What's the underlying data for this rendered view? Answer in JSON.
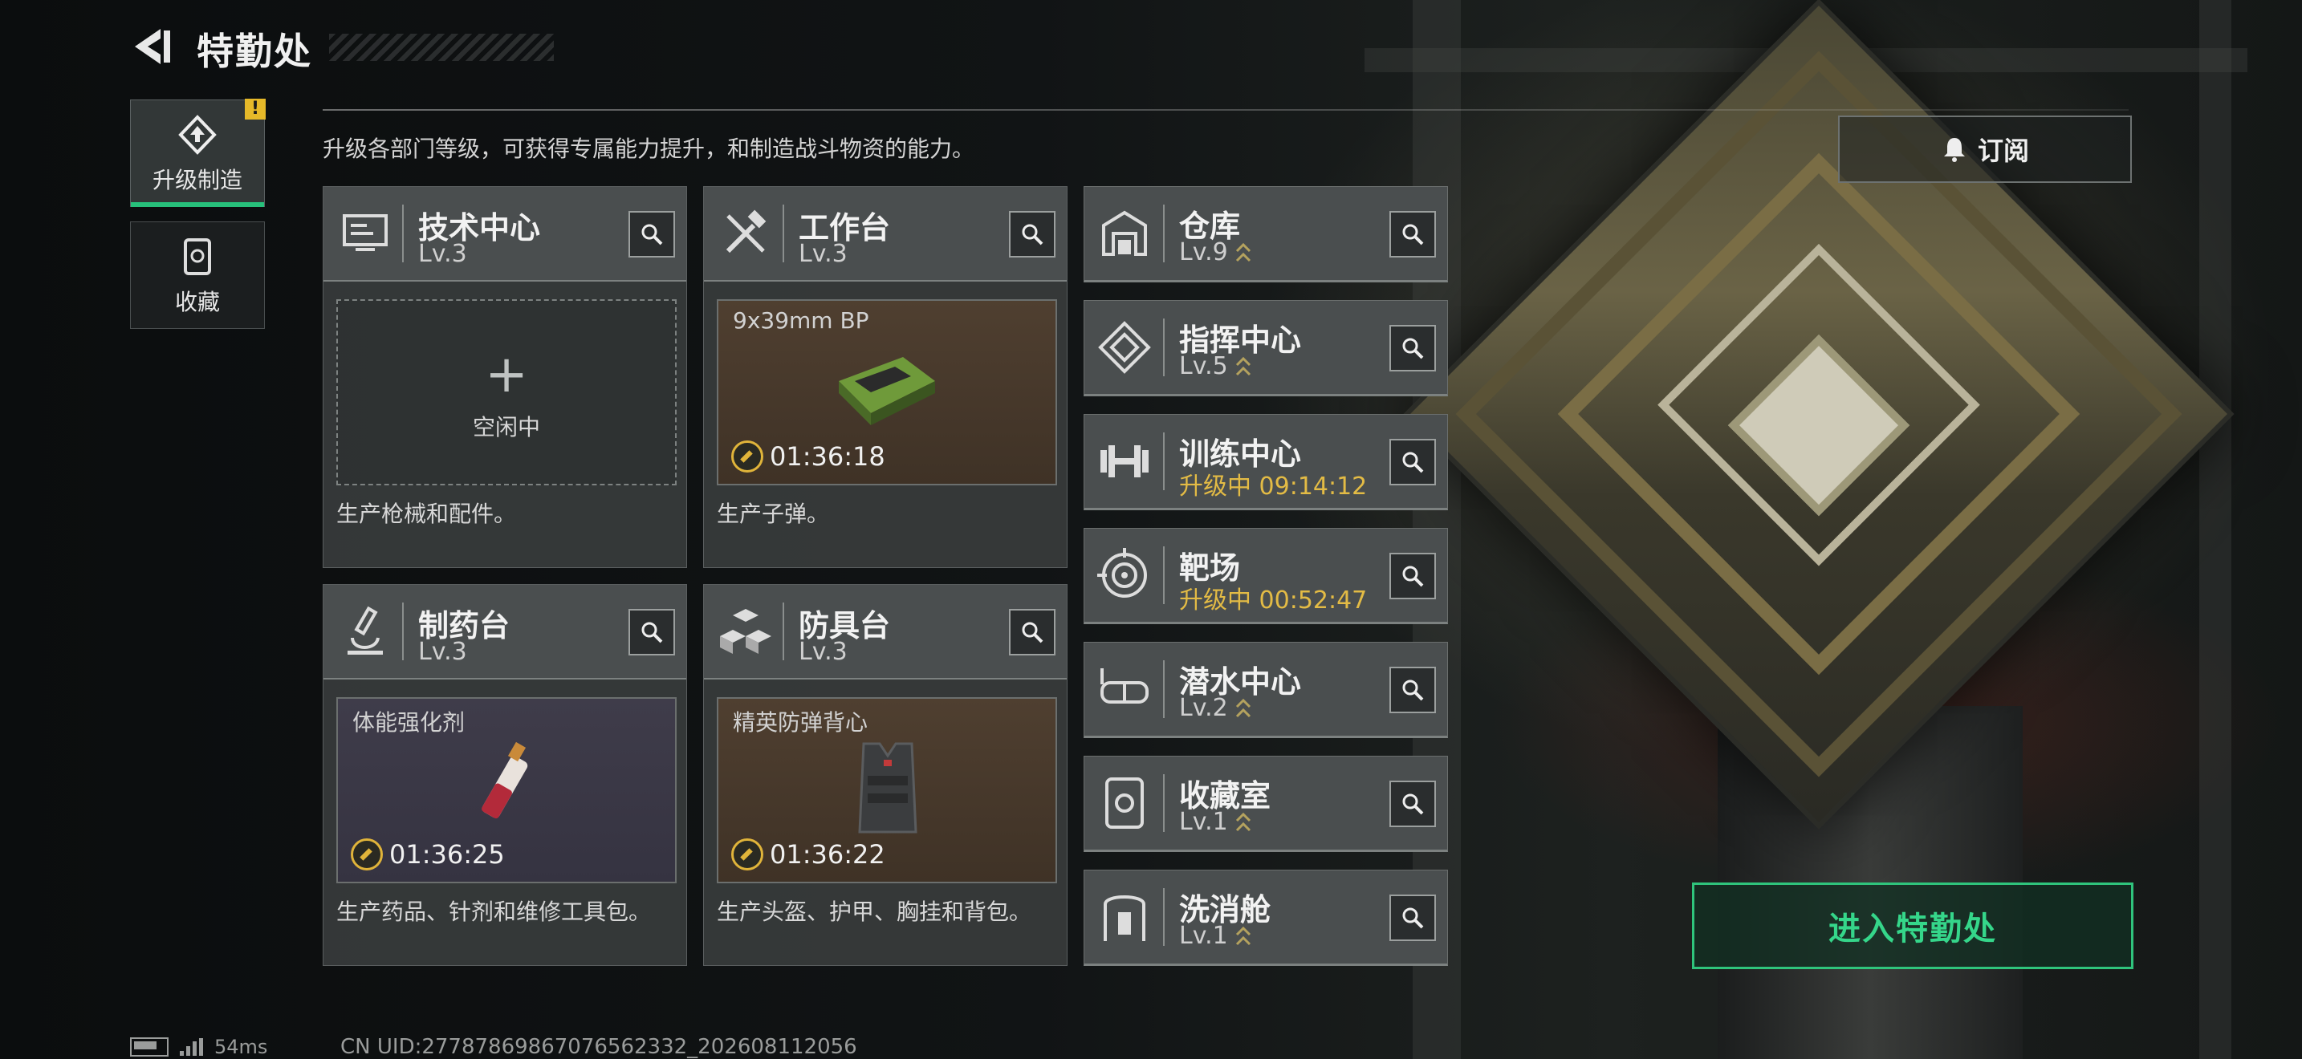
{
  "header": {
    "title": "特勤处"
  },
  "sidetabs": [
    {
      "label": "升级制造",
      "badge": "!",
      "active": true
    },
    {
      "label": "收藏",
      "active": false
    }
  ],
  "description": "升级各部门等级，可获得专属能力提升，和制造战斗物资的能力。",
  "subscribe_label": "订阅",
  "cards": [
    {
      "name": "技术中心",
      "level": "Lv.3",
      "slot_text": "空闲中",
      "footer": "生产枪械和配件。"
    },
    {
      "name": "工作台",
      "level": "Lv.3",
      "item_name": "9x39mm BP",
      "timer": "01:36:18",
      "footer": "生产子弹。"
    },
    {
      "name": "制药台",
      "level": "Lv.3",
      "item_name": "体能强化剂",
      "timer": "01:36:25",
      "footer": "生产药品、针剂和维修工具包。"
    },
    {
      "name": "防具台",
      "level": "Lv.3",
      "item_name": "精英防弹背心",
      "timer": "01:36:22",
      "footer": "生产头盔、护甲、胸挂和背包。"
    }
  ],
  "departments": [
    {
      "name": "仓库",
      "status": "Lv.9",
      "upgrading": false,
      "icon": "warehouse-icon"
    },
    {
      "name": "指挥中心",
      "status": "Lv.5",
      "upgrading": false,
      "icon": "command-icon"
    },
    {
      "name": "训练中心",
      "status": "升级中 09:14:12",
      "upgrading": true,
      "icon": "dumbbell-icon"
    },
    {
      "name": "靶场",
      "status": "升级中 00:52:47",
      "upgrading": true,
      "icon": "target-icon"
    },
    {
      "name": "潜水中心",
      "status": "Lv.2",
      "upgrading": false,
      "icon": "goggles-icon"
    },
    {
      "name": "收藏室",
      "status": "Lv.1",
      "upgrading": false,
      "icon": "collection-icon"
    },
    {
      "name": "洗消舱",
      "status": "Lv.1",
      "upgrading": false,
      "icon": "decon-icon"
    }
  ],
  "enter_button": "进入特勤处",
  "status_bar": {
    "ping": "54ms",
    "uid": "CN UID:27787869867076562332_202608112056"
  },
  "colors": {
    "accent_green": "#2fc47c",
    "upgrade_yellow": "#e3bb45",
    "badge_yellow": "#e6b929"
  }
}
